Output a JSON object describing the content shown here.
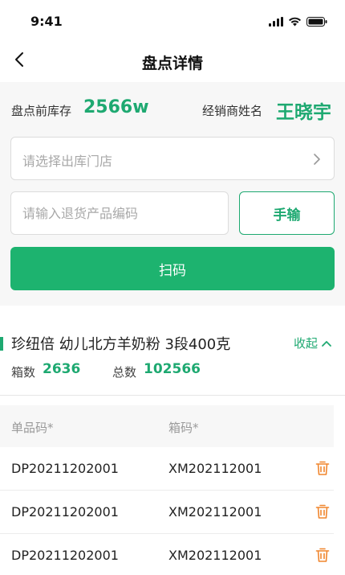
{
  "status_bar": {
    "time": "9:41"
  },
  "nav": {
    "title": "盘点详情"
  },
  "summary": {
    "stock_label": "盘点前库存",
    "stock_value": "2566w",
    "dealer_label": "经销商姓名",
    "dealer_name": "王晓宇"
  },
  "form": {
    "store_placeholder": "请选择出库门店",
    "code_placeholder": "请输入退货产品编码",
    "manual_label": "手输",
    "scan_label": "扫码"
  },
  "product": {
    "name": "珍纽倍 幼儿北方羊奶粉 3段400克",
    "collapse_label": "收起",
    "box_label": "箱数",
    "box_value": "2636",
    "total_label": "总数",
    "total_value": "102566"
  },
  "table": {
    "headers": [
      "单品码*",
      "箱码*"
    ],
    "rows": [
      [
        "DP20211202001",
        "XM202112001"
      ],
      [
        "DP20211202001",
        "XM202112001"
      ],
      [
        "DP20211202001",
        "XM202112001"
      ]
    ]
  },
  "colors": {
    "accent": "#1ea971",
    "delete": "#f0852d"
  },
  "icons": [
    "signal-icon",
    "wifi-icon",
    "battery-icon",
    "back-arrow-icon",
    "chevron-right-icon",
    "chevron-up-icon",
    "trash-icon"
  ]
}
